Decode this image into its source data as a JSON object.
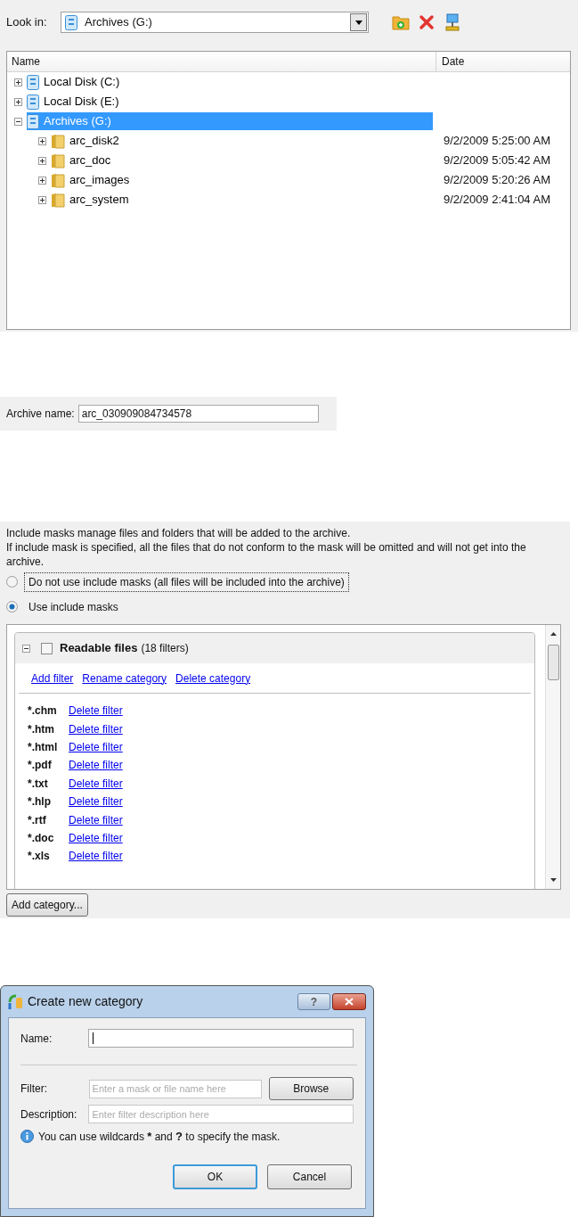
{
  "browser": {
    "look_in_label": "Look in:",
    "look_in_value": "Archives (G:)",
    "columns": [
      "Name",
      "Date"
    ],
    "tree": [
      {
        "name": "Local Disk (C:)",
        "kind": "drive",
        "expanded": false,
        "selected": false
      },
      {
        "name": "Local Disk (E:)",
        "kind": "drive",
        "expanded": false,
        "selected": false
      },
      {
        "name": "Archives (G:)",
        "kind": "drive",
        "expanded": true,
        "selected": true,
        "children": [
          {
            "name": "arc_disk2",
            "kind": "folder",
            "date": "9/2/2009 5:25:00 AM",
            "expanded": false,
            "selected": false
          },
          {
            "name": "arc_doc",
            "kind": "folder",
            "date": "9/2/2009 5:05:42 AM",
            "expanded": false,
            "selected": false
          },
          {
            "name": "arc_images",
            "kind": "folder",
            "date": "9/2/2009 5:20:26 AM",
            "expanded": false,
            "selected": false
          },
          {
            "name": "arc_system",
            "kind": "folder",
            "date": "9/2/2009 2:41:04 AM",
            "expanded": false,
            "selected": false
          }
        ]
      }
    ]
  },
  "archive": {
    "label": "Archive name:",
    "value": "arc_030909084734578"
  },
  "masks": {
    "intro": "Include masks manage files and folders that will be added to the archive.\nIf include mask is specified, all the files that do not conform to the mask will be omitted and will not get into the archive.",
    "options": [
      {
        "label": "Do not use include masks (all files will be included into the archive)",
        "selected": false,
        "focused": true
      },
      {
        "label": "Use include masks",
        "selected": true,
        "focused": false
      }
    ],
    "category": {
      "name": "Readable files",
      "count": "(18 filters)",
      "checked": false,
      "expanded": true,
      "actions": [
        "Add filter",
        "Rename category",
        "Delete category"
      ],
      "filters": [
        {
          "mask": "*.chm",
          "action": "Delete filter"
        },
        {
          "mask": "*.htm",
          "action": "Delete filter"
        },
        {
          "mask": "*.html",
          "action": "Delete filter"
        },
        {
          "mask": "*.pdf",
          "action": "Delete filter"
        },
        {
          "mask": "*.txt",
          "action": "Delete filter"
        },
        {
          "mask": "*.hlp",
          "action": "Delete filter"
        },
        {
          "mask": "*.rtf",
          "action": "Delete filter"
        },
        {
          "mask": "*.doc",
          "action": "Delete filter"
        },
        {
          "mask": "*.xls",
          "action": "Delete filter"
        }
      ]
    },
    "add_button": "Add category..."
  },
  "dialog": {
    "title": "Create new category",
    "help": "?",
    "name_label": "Name:",
    "filter_label": "Filter:",
    "filter_placeholder": "Enter a mask or file name here",
    "browse": "Browse",
    "description_label": "Description:",
    "description_placeholder": "Enter filter description here",
    "hint": [
      {
        "text": "You can use wildcards ",
        "bold": false
      },
      {
        "text": "*",
        "bold": true
      },
      {
        "text": " and ",
        "bold": false
      },
      {
        "text": "?",
        "bold": true
      },
      {
        "text": " to specify the mask.",
        "bold": false
      }
    ],
    "buttons": [
      {
        "label": "OK",
        "default": true
      },
      {
        "label": "Cancel",
        "default": false
      }
    ]
  }
}
